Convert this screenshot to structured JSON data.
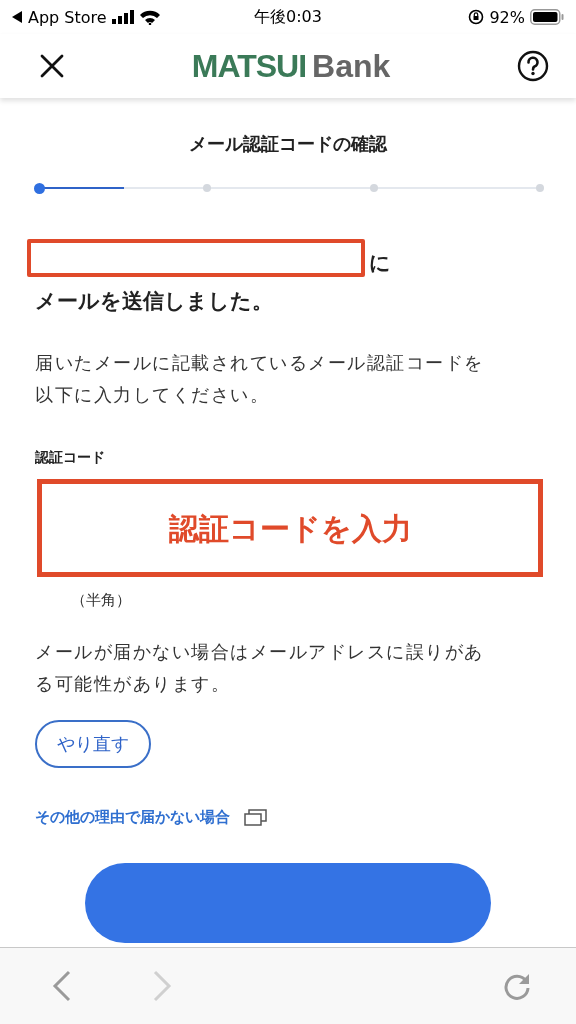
{
  "status_bar": {
    "back_app": "App Store",
    "time": "午後0:03",
    "battery": "92%"
  },
  "header": {
    "logo_primary": "MATSUI",
    "logo_secondary": "Bank"
  },
  "title": "メール認証コードの確認",
  "progress": {
    "level": 0.17,
    "steps": [
      {
        "selected": true
      },
      {
        "selected": false
      },
      {
        "selected": false
      },
      {
        "selected": false
      }
    ]
  },
  "recipient": {
    "kind": "redacted",
    "suffix": "に"
  },
  "sent_message": "メールを送信しました。",
  "instructions": "届いたメールに記載されているメール認証コードを以下に入力してください。",
  "code_field": {
    "label": "認証コード",
    "placeholder": "認証コードを入力",
    "highlighted": true,
    "note": "（半角）"
  },
  "notice": "メールが届かない場合はメールアドレスに誤りがある可能性があります。",
  "retry_button": "やり直す",
  "help_link": "その他の理由で届かない場合",
  "browser_toolbar": {
    "back": {
      "disabled": false
    },
    "forward": {
      "disabled": true
    }
  }
}
